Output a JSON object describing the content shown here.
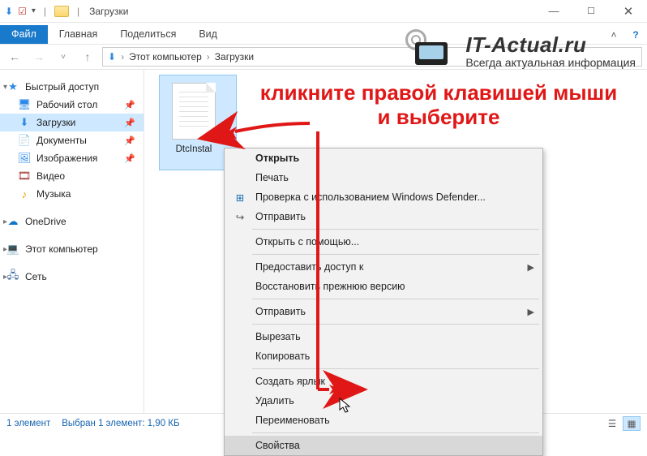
{
  "title": "Загрузки",
  "qat": {
    "sep": "|"
  },
  "ribbon": {
    "file": "Файл",
    "home": "Главная",
    "share": "Поделиться",
    "view": "Вид"
  },
  "breadcrumb": {
    "root_sep": "›",
    "pc": "Этот компьютер",
    "sep1": "›",
    "folder": "Загрузки"
  },
  "sidebar": {
    "quick": "Быстрый доступ",
    "desktop": "Рабочий стол",
    "downloads": "Загрузки",
    "documents": "Документы",
    "pictures": "Изображения",
    "videos": "Видео",
    "music": "Музыка",
    "onedrive": "OneDrive",
    "thispc": "Этот компьютер",
    "network": "Сеть"
  },
  "file": {
    "name": "DtcInstal"
  },
  "context": {
    "open": "Открыть",
    "print": "Печать",
    "defender": "Проверка с использованием Windows Defender...",
    "share": "Отправить",
    "openwith": "Открыть с помощью...",
    "grant": "Предоставить доступ к",
    "restore": "Восстановить прежнюю версию",
    "sendto": "Отправить",
    "cut": "Вырезать",
    "copy": "Копировать",
    "shortcut": "Создать ярлык",
    "delete": "Удалить",
    "rename": "Переименовать",
    "properties": "Свойства"
  },
  "status": {
    "count": "1 элемент",
    "selection": "Выбран 1 элемент: 1,90 КБ"
  },
  "annotation": {
    "line1": "кликните правой клавишей мыши",
    "line2": "и выберите"
  },
  "brand": {
    "name": "IT-Actual.ru",
    "sub": "Всегда актуальная информация"
  }
}
